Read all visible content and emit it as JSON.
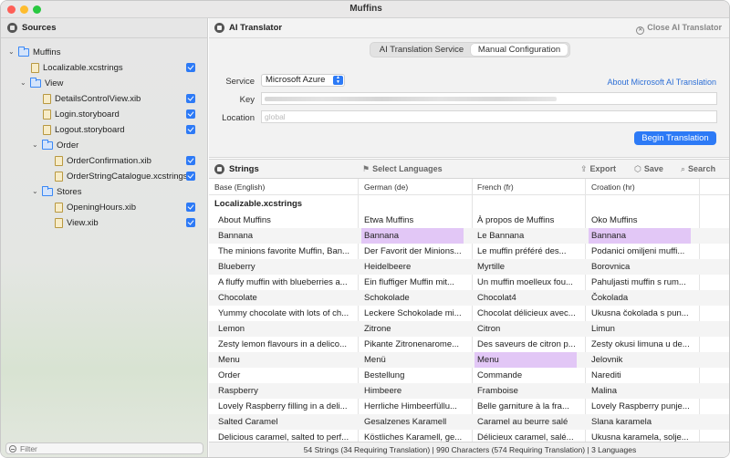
{
  "window": {
    "title": "Muffins"
  },
  "sidebar": {
    "header": "Sources",
    "items": [
      {
        "label": "Muffins",
        "kind": "folder",
        "depth": 0,
        "expanded": true,
        "checked": false
      },
      {
        "label": "Localizable.xcstrings",
        "kind": "file",
        "depth": 1,
        "checked": true
      },
      {
        "label": "View",
        "kind": "folder",
        "depth": 1,
        "expanded": true,
        "checked": false
      },
      {
        "label": "DetailsControlView.xib",
        "kind": "file",
        "depth": 2,
        "checked": true
      },
      {
        "label": "Login.storyboard",
        "kind": "file",
        "depth": 2,
        "checked": true
      },
      {
        "label": "Logout.storyboard",
        "kind": "file",
        "depth": 2,
        "checked": true
      },
      {
        "label": "Order",
        "kind": "folder",
        "depth": 2,
        "expanded": true,
        "checked": false
      },
      {
        "label": "OrderConfirmation.xib",
        "kind": "file",
        "depth": 3,
        "checked": true
      },
      {
        "label": "OrderStringCatalogue.xcstrings",
        "kind": "file",
        "depth": 3,
        "checked": true
      },
      {
        "label": "Stores",
        "kind": "folder",
        "depth": 2,
        "expanded": true,
        "checked": false
      },
      {
        "label": "OpeningHours.xib",
        "kind": "file",
        "depth": 3,
        "checked": true
      },
      {
        "label": "View.xib",
        "kind": "file",
        "depth": 3,
        "checked": true
      }
    ],
    "filter_placeholder": "Filter"
  },
  "translator": {
    "title": "AI Translator",
    "close_label": "Close AI Translator",
    "tabs": [
      "AI Translation Service",
      "Manual Configuration"
    ],
    "active_tab": "Manual Configuration",
    "service_label": "Service",
    "service_value": "Microsoft Azure",
    "about_link": "About Microsoft AI Translation",
    "key_label": "Key",
    "location_label": "Location",
    "location_placeholder": "global",
    "begin_button": "Begin Translation"
  },
  "strings": {
    "title": "Strings",
    "select_languages": "Select Languages",
    "export": "Export",
    "save": "Save",
    "search": "Search",
    "columns": [
      "Base (English)",
      "German (de)",
      "French (fr)",
      "Croation (hr)"
    ],
    "section": "Localizable.xcstrings",
    "rows": [
      [
        "About Muffins",
        "Etwa Muffins",
        "À propos de Muffins",
        "Oko Muffins"
      ],
      [
        "Bannana",
        "Bannana",
        "Le Bannana",
        "Bannana"
      ],
      [
        "The minions favorite Muffin, Ban...",
        "Der Favorit der Minions...",
        "Le muffin préféré des...",
        "Podanici omiljeni muffi..."
      ],
      [
        "Blueberry",
        "Heidelbeere",
        "Myrtille",
        "Borovnica"
      ],
      [
        "A fluffy muffin with blueberries a...",
        "Ein fluffiger Muffin mit...",
        "Un muffin moelleux fou...",
        "Pahuljasti muffin s rum..."
      ],
      [
        "Chocolate",
        "Schokolade",
        "Chocolat4",
        "Čokolada"
      ],
      [
        "Yummy chocolate with lots of ch...",
        "Leckere Schokolade mi...",
        "Chocolat délicieux avec...",
        "Ukusna čokolada s pun..."
      ],
      [
        "Lemon",
        "Zitrone",
        "Citron",
        "Limun"
      ],
      [
        "Zesty lemon flavours in a delico...",
        "Pikante Zitronenarome...",
        "Des saveurs de citron p...",
        "Zesty okusi limuna u de..."
      ],
      [
        "Menu",
        "Menü",
        "Menu",
        "Jelovnik"
      ],
      [
        "Order",
        "Bestellung",
        "Commande",
        "Narediti"
      ],
      [
        "Raspberry",
        "Himbeere",
        "Framboise",
        "Malina"
      ],
      [
        "Lovely Raspberry filling in a deli...",
        "Herrliche Himbeerfüllu...",
        "Belle garniture à la fra...",
        "Lovely Raspberry punje..."
      ],
      [
        "Salted Caramel",
        "Gesalzenes Karamell",
        "Caramel au beurre salé",
        "Slana karamela"
      ],
      [
        "Delicious caramel, salted to perf...",
        "Köstliches Karamell, ge...",
        "Délicieux caramel, salé...",
        "Ukusna karamela, solje..."
      ]
    ],
    "highlighted": [
      [
        1,
        1
      ],
      [
        1,
        3
      ],
      [
        9,
        2
      ]
    ],
    "highlight_color": "#e2c7f6",
    "status": "54 Strings (34 Requiring Translation) | 990 Characters (574 Requiring Translation) | 3 Languages"
  },
  "colors": {
    "accent": "#2d7af6",
    "link": "#2d6fd6"
  }
}
